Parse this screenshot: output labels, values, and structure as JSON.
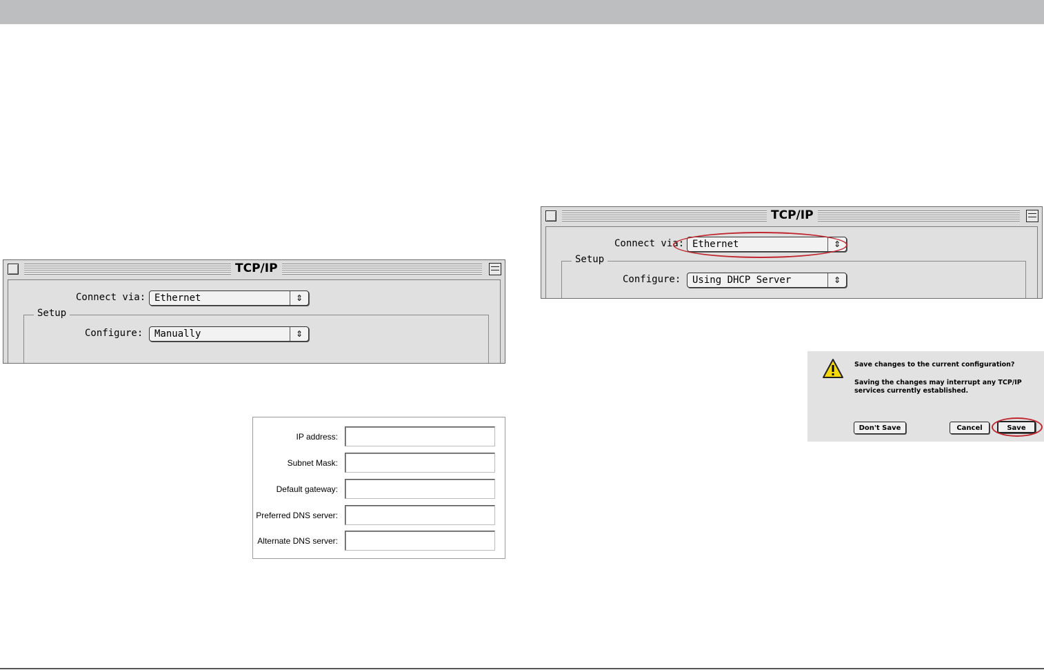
{
  "left_window": {
    "title": "TCP/IP",
    "connect_via_label": "Connect via:",
    "connect_via_value": "Ethernet",
    "setup_label": "Setup",
    "configure_label": "Configure:",
    "configure_value": "Manually"
  },
  "right_window": {
    "title": "TCP/IP",
    "connect_via_label": "Connect via:",
    "connect_via_value": "Ethernet",
    "setup_label": "Setup",
    "configure_label": "Configure:",
    "configure_value": "Using DHCP Server"
  },
  "ip_form": {
    "fields": [
      {
        "label": "IP address:"
      },
      {
        "label": "Subnet Mask:"
      },
      {
        "label": "Default gateway:"
      },
      {
        "label": "Preferred DNS server:"
      },
      {
        "label": "Alternate DNS server:"
      }
    ]
  },
  "dialog": {
    "heading": "Save changes to the current configuration?",
    "body_line1": "Saving the changes may interrupt any TCP/IP",
    "body_line2": "services currently established.",
    "dont_save": "Don't Save",
    "cancel": "Cancel",
    "save": "Save",
    "icon": "warning-icon"
  },
  "colors": {
    "highlight": "#c0262e",
    "top_bar": "#bcbec0"
  }
}
